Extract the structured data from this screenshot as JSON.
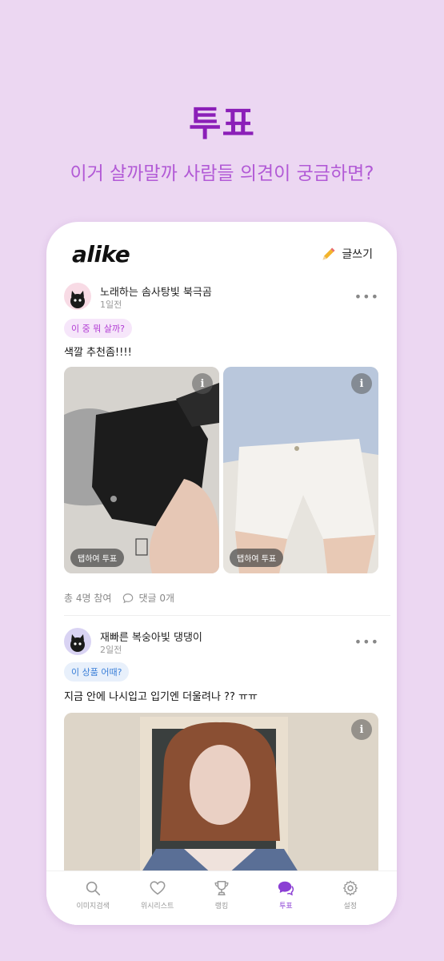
{
  "hero": {
    "title": "투표",
    "subtitle": "이거 살까말까 사람들 의견이 궁금하면?"
  },
  "app": {
    "logo": "alike",
    "write_label": "글쓰기"
  },
  "posts": [
    {
      "author": "노래하는 솜사탕빛 북극곰",
      "time": "1일전",
      "tag": "이 중 뭐 살까?",
      "caption": "색깔 추천좀!!!!",
      "images": [
        {
          "tap_label": "탭하여 투표",
          "color": "#1e1e1e"
        },
        {
          "tap_label": "탭하여 투표",
          "color": "#ece9e2"
        }
      ],
      "participants": "총 4명 참여",
      "comments": "댓글 0개"
    },
    {
      "author": "재빠른 복숭아빛 댕댕이",
      "time": "2일전",
      "tag": "이 상품 어때?",
      "caption": "지금 안에 나시입고 입기엔 더울려나 ?? ㅠㅠ"
    }
  ],
  "nav": [
    {
      "label": "이미지검색",
      "icon": "search-icon"
    },
    {
      "label": "위시리스트",
      "icon": "heart-icon"
    },
    {
      "label": "랭킹",
      "icon": "trophy-icon"
    },
    {
      "label": "투표",
      "icon": "chat-bubbles-icon",
      "active": true
    },
    {
      "label": "설정",
      "icon": "gear-icon"
    }
  ],
  "colors": {
    "background": "#ecd7f2",
    "hero_title": "#8b1fb8",
    "hero_subtitle": "#b25ad6",
    "accent": "#8b3fd4"
  }
}
